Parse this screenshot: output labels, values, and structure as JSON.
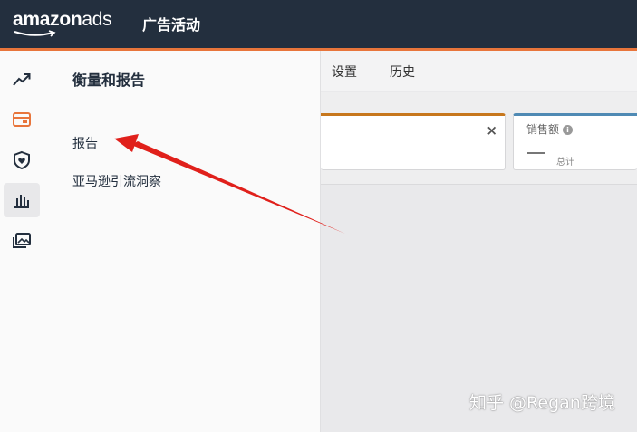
{
  "header": {
    "logo_amazon": "amazon",
    "logo_ads": "ads",
    "title": "广告活动"
  },
  "subnav": {
    "items": [
      "设置",
      "历史"
    ]
  },
  "metrics": {
    "card2_label": "销售额",
    "card2_info": "i",
    "card2_sub": "总计",
    "card1_close": "×"
  },
  "sidebar": {
    "icons": [
      "trend-chart-icon",
      "campaign-card-icon",
      "shield-heart-icon",
      "bar-chart-icon",
      "image-gallery-icon"
    ],
    "active_index": 3
  },
  "flyout": {
    "heading": "衡量和报告",
    "items": [
      "报告",
      "亚马逊引流洞察"
    ]
  },
  "annotation": {
    "arrow_color": "#e0201b"
  },
  "watermark": "知乎 @Regan跨境",
  "colors": {
    "topbar": "#232f3e",
    "accent": "#e8753b",
    "card1_border": "#c7771d",
    "card2_border": "#4f8ab4"
  }
}
